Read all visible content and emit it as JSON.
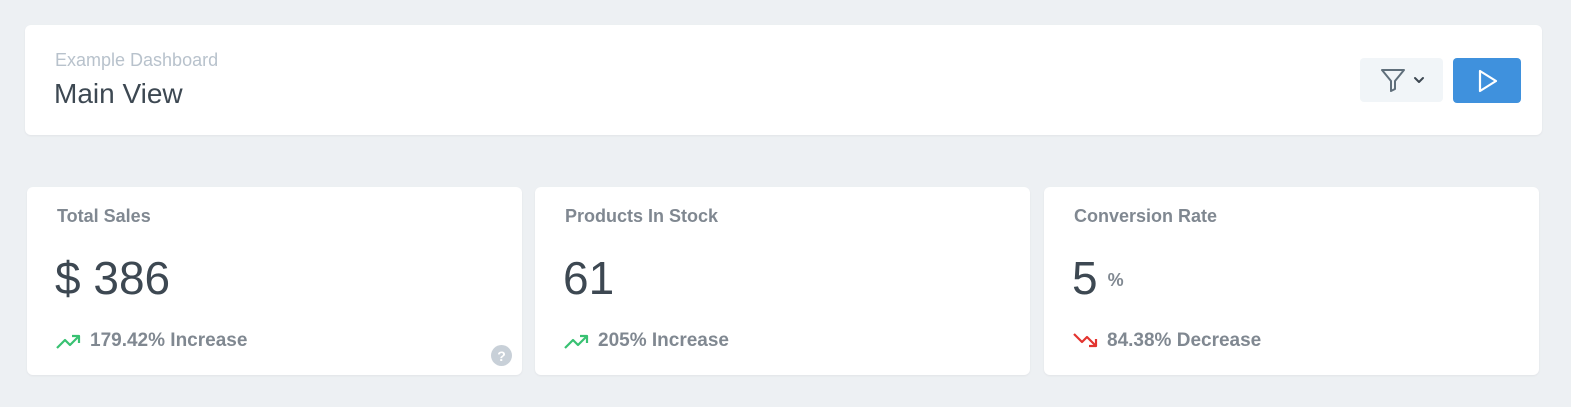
{
  "header": {
    "breadcrumb": "Example Dashboard",
    "title": "Main View",
    "filter_icon": "filter-icon",
    "run_icon": "play-icon"
  },
  "metrics": [
    {
      "title": "Total Sales",
      "value": "$ 386",
      "suffix": "",
      "change": "179.42% Increase",
      "trend": "up",
      "help_icon": "?"
    },
    {
      "title": "Products In Stock",
      "value": "61",
      "suffix": "",
      "change": "205% Increase",
      "trend": "up"
    },
    {
      "title": "Conversion Rate",
      "value": "5",
      "suffix": "%",
      "change": "84.38% Decrease",
      "trend": "down"
    }
  ],
  "colors": {
    "background": "#edf0f3",
    "primary": "#3f91dd",
    "increase": "#38c172",
    "decrease": "#e3342f",
    "title": "#3d4852",
    "muted": "#808891"
  }
}
